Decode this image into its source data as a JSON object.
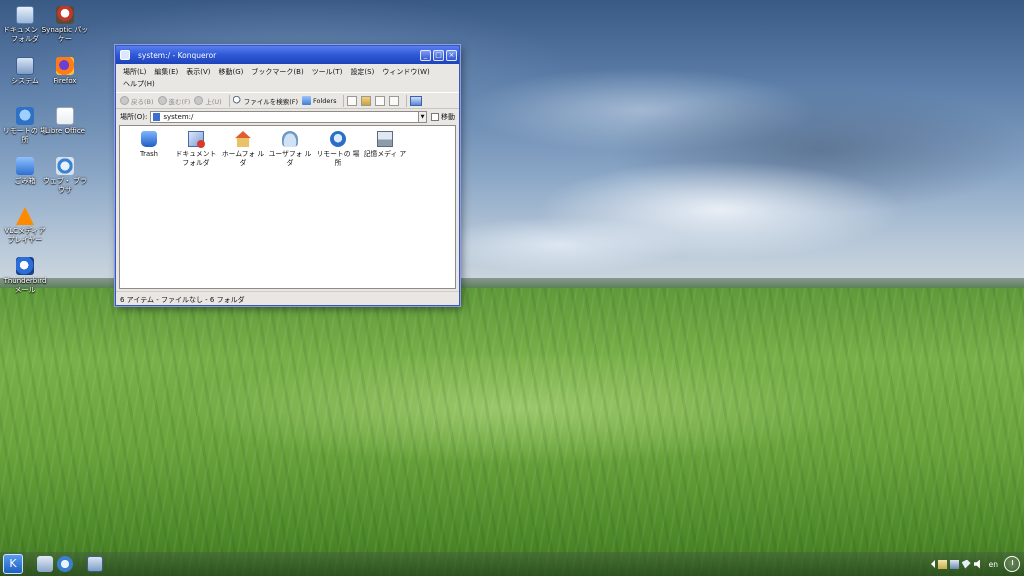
{
  "desktop": {
    "icons": [
      {
        "label": "ドキュメン トフォルダ",
        "icon": "documents-folder-icon"
      },
      {
        "label": "Synaptic パッケー",
        "icon": "synaptic-icon"
      },
      {
        "label": "システム",
        "icon": "system-icon"
      },
      {
        "label": "Firefox",
        "icon": "firefox-icon"
      },
      {
        "label": "リモートの 場所",
        "icon": "remote-places-icon"
      },
      {
        "label": "Libre Office",
        "icon": "libreoffice-icon"
      },
      {
        "label": "ごみ箱",
        "icon": "trash-icon"
      },
      {
        "label": "ウェブ・ ブラウザ",
        "icon": "web-browser-icon"
      },
      {
        "label": "VLCメディア プレイヤー",
        "icon": "vlc-icon"
      },
      {
        "label": "Thunderbird メール",
        "icon": "thunderbird-icon"
      }
    ]
  },
  "window": {
    "title": "system:/ - Konqueror",
    "buttons": {
      "minimize": "_",
      "maximize": "□",
      "close": "×"
    },
    "menu": [
      "場所(L)",
      "編集(E)",
      "表示(V)",
      "移動(G)",
      "ブックマーク(B)",
      "ツール(T)",
      "設定(S)",
      "ウィンドウ(W)",
      "ヘルプ(H)"
    ],
    "toolbar": {
      "back": "戻る(B)",
      "forward": "進む(F)",
      "up": "上(U)",
      "find": "ファイルを検索(F)",
      "folders": "Folders"
    },
    "location": {
      "label": "場所(O):",
      "value": "system:/",
      "go": "移動"
    },
    "items": [
      {
        "label": "Trash",
        "icon": "trash-icon"
      },
      {
        "label": "ドキュメント フォルダ",
        "icon": "documents-folder-icon"
      },
      {
        "label": "ホームフォ ルダ",
        "icon": "home-folder-icon"
      },
      {
        "label": "ユーザフォ ルダ",
        "icon": "users-folder-icon"
      },
      {
        "label": "リモートの 場所",
        "icon": "remote-places-icon"
      },
      {
        "label": "記憶メディ ア",
        "icon": "storage-media-icon"
      }
    ],
    "status": "6 アイテム - ファイルなし - 6 フォルダ"
  },
  "taskbar": {
    "language": "en"
  }
}
